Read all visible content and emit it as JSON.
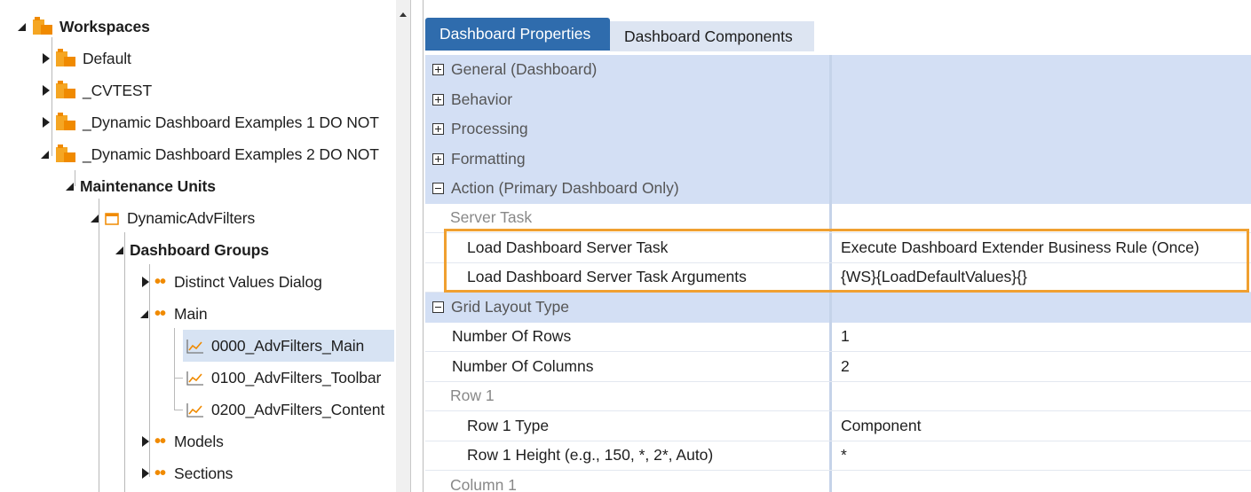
{
  "tree": {
    "root": "Workspaces",
    "workspaces": [
      "Default",
      "_CVTEST",
      "_Dynamic Dashboard Examples 1 DO NOT",
      "_Dynamic Dashboard Examples 2 DO NOT"
    ],
    "maintenance_units": "Maintenance Units",
    "unit": "DynamicAdvFilters",
    "dashboard_groups": "Dashboard Groups",
    "groups": [
      "Distinct Values Dialog",
      "Main",
      "Models",
      "Sections"
    ],
    "dashboards": [
      "0000_AdvFilters_Main",
      "0100_AdvFilters_Toolbar",
      "0200_AdvFilters_Content"
    ]
  },
  "tabs": {
    "properties": "Dashboard Properties",
    "components": "Dashboard Components"
  },
  "properties": {
    "categories": {
      "general": "General (Dashboard)",
      "behavior": "Behavior",
      "processing": "Processing",
      "formatting": "Formatting",
      "action": "Action (Primary Dashboard Only)",
      "grid_layout": "Grid Layout Type"
    },
    "server_task": "Server Task",
    "load_task_label": "Load Dashboard Server Task",
    "load_task_value": "Execute Dashboard Extender Business Rule (Once)",
    "load_args_label": "Load Dashboard Server Task Arguments",
    "load_args_value": "{WS}{LoadDefaultValues}{}",
    "rows_label": "Number Of Rows",
    "rows_value": "1",
    "cols_label": "Number Of Columns",
    "cols_value": "2",
    "row1": "Row 1",
    "row1_type_label": "Row 1 Type",
    "row1_type_value": "Component",
    "row1_height_label": "Row 1 Height (e.g., 150, *, 2*, Auto)",
    "row1_height_value": "*",
    "col1": "Column 1"
  },
  "colors": {
    "active_tab": "#2f6cad",
    "category_row": "#d3dff4",
    "highlight": "#f0a030",
    "tree_icon": "#f08a00"
  }
}
